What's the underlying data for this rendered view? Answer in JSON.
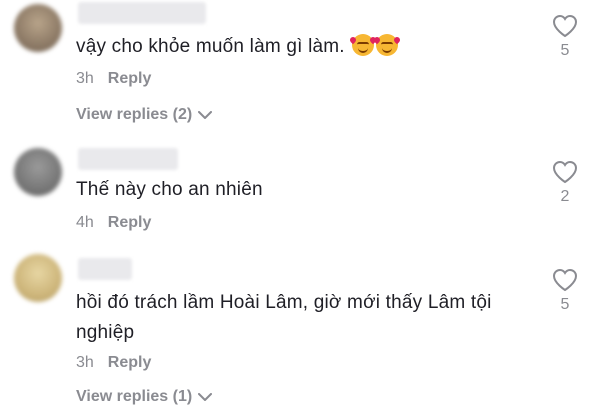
{
  "comments": [
    {
      "text": "vậy cho khỏe muốn làm gì làm.",
      "time": "3h",
      "reply_label": "Reply",
      "likes": "5",
      "view_replies": "View replies (2)",
      "emoji_icons": [
        "smiling-face-with-hearts-icon",
        "smiling-face-with-hearts-icon"
      ]
    },
    {
      "text": "Thế này cho an nhiên",
      "time": "4h",
      "reply_label": "Reply",
      "likes": "2"
    },
    {
      "text": "hồi đó trách lầm Hoài Lâm, giờ mới thấy Lâm tội nghiệp",
      "time": "3h",
      "reply_label": "Reply",
      "likes": "5",
      "view_replies": "View replies (1)"
    }
  ],
  "icons": {
    "like": "heart-outline-icon",
    "expand": "chevron-down-icon"
  },
  "colors": {
    "text": "#1f1f26",
    "muted": "#8a8b91",
    "background": "#ffffff"
  }
}
